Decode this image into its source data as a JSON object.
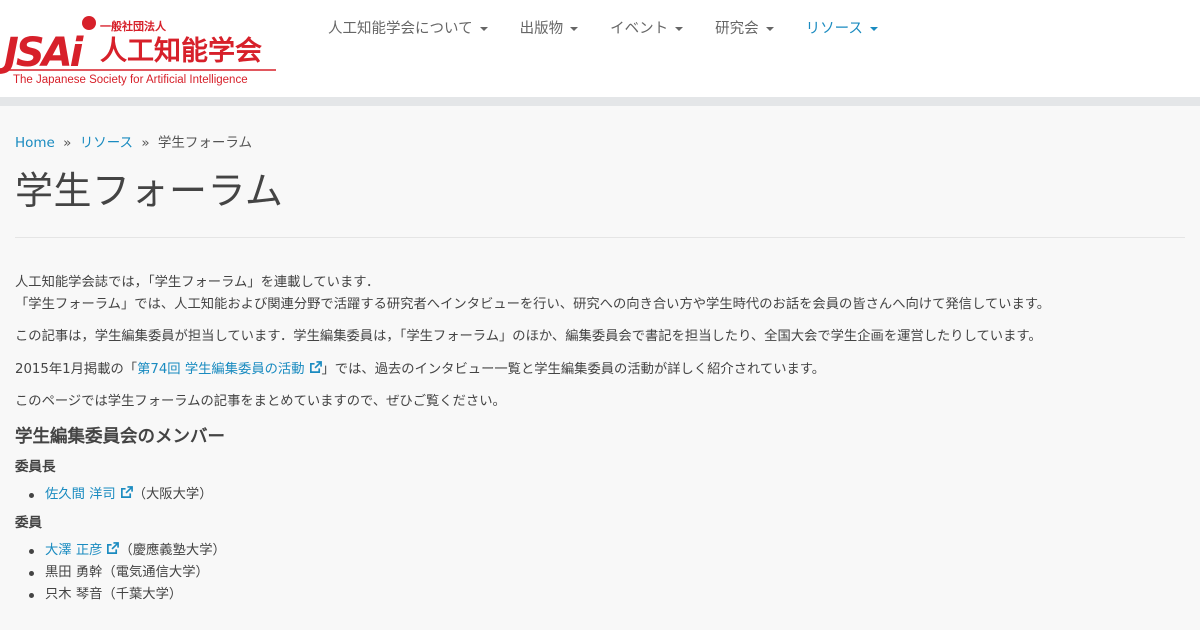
{
  "logo": {
    "mark": "JSAI",
    "corp_type": "一般社団法人",
    "name_ja": "人工知能学会",
    "name_en": "The Japanese Society for Artificial Intelligence"
  },
  "nav": {
    "items": [
      {
        "label": "人工知能学会について"
      },
      {
        "label": "出版物"
      },
      {
        "label": "イベント"
      },
      {
        "label": "研究会"
      },
      {
        "label": "リソース"
      }
    ]
  },
  "breadcrumb": {
    "home": "Home",
    "sep1": "»",
    "resources": "リソース",
    "sep2": "»",
    "current": "学生フォーラム"
  },
  "page": {
    "title": "学生フォーラム"
  },
  "intro": {
    "line1": "人工知能学会誌では，「学生フォーラム」を連載しています．",
    "line2": "「学生フォーラム」では、人工知能および関連分野で活躍する研究者へインタビューを行い、研究への向き合い方や学生時代のお話を会員の皆さんへ向けて発信しています。",
    "para2": "この記事は，学生編集委員が担当しています．学生編集委員は，「学生フォーラム」のほか、編集委員会で書記を担当したり、全国大会で学生企画を運営したりしています。",
    "para3_before": "2015年1月掲載の「",
    "para3_link": "第74回 学生編集委員の活動",
    "para3_after": "」では、過去のインタビュー一覧と学生編集委員の活動が詳しく紹介されています。",
    "para4": "このページでは学生フォーラムの記事をまとめていますので、ぜひご覧ください。"
  },
  "members": {
    "heading": "学生編集委員会のメンバー",
    "chair_label": "委員長",
    "chair": [
      {
        "name": "佐久間 洋司",
        "affiliation": "（大阪大学）"
      }
    ],
    "member_label": "委員",
    "members": [
      {
        "name": "大澤 正彦",
        "affiliation": "（慶應義塾大学）"
      },
      {
        "name": "黒田 勇幹",
        "affiliation": "（電気通信大学）"
      },
      {
        "name": "只木 琴音",
        "affiliation": "（千葉大学）"
      }
    ]
  },
  "colors": {
    "brand_red": "#d7202a",
    "link": "#1a8bc0",
    "text": "#444444"
  }
}
